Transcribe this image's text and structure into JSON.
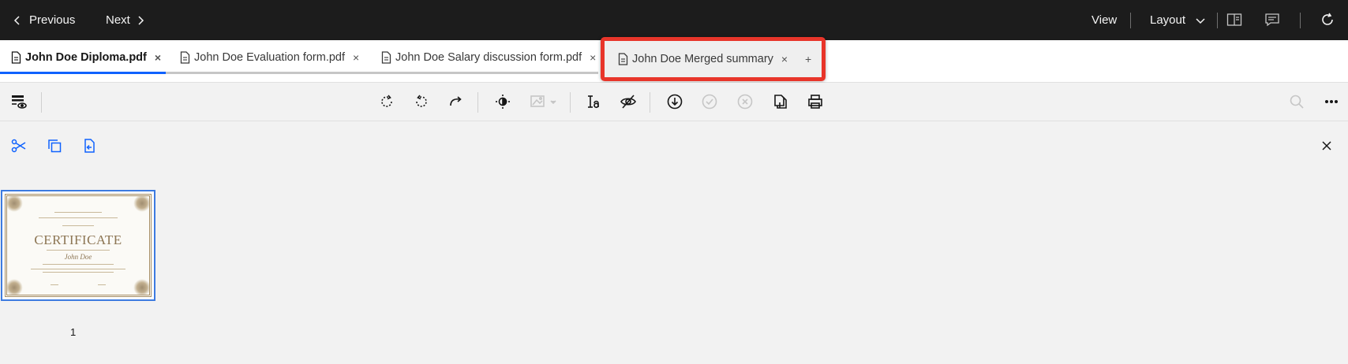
{
  "topbar": {
    "previous_label": "Previous",
    "next_label": "Next",
    "view_label": "View",
    "layout_label": "Layout"
  },
  "tabs": [
    {
      "label": "John Doe Diploma.pdf",
      "close": "×",
      "active": true
    },
    {
      "label": "John Doe Evaluation form.pdf",
      "close": "×",
      "active": false
    },
    {
      "label": "John Doe Salary discussion form.pdf",
      "close": "×",
      "active": false
    },
    {
      "label": "John Doe Merged summary",
      "close": "×",
      "active": false
    }
  ],
  "add_tab_label": "+",
  "toolbar": {
    "icons": [
      "view-options-icon",
      "rotate-clockwise-icon",
      "rotate-counterclockwise-icon",
      "redo-icon",
      "contrast-icon",
      "image-adjust-icon",
      "text-ocr-icon",
      "hide-icon",
      "download-icon",
      "approve-icon",
      "reject-icon",
      "copy-pages-icon",
      "print-icon",
      "search-icon",
      "overflow-menu-icon"
    ]
  },
  "subtools": {
    "icons": [
      "cut-icon",
      "copy-icon",
      "move-pages-icon"
    ],
    "close_label": "×"
  },
  "thumbnail": {
    "title": "CERTIFICATE",
    "name": "John Doe",
    "page_number": "1"
  },
  "colors": {
    "topbar_bg": "#1c1c1c",
    "accent": "#0f62fe",
    "highlight": "#e8352a"
  }
}
